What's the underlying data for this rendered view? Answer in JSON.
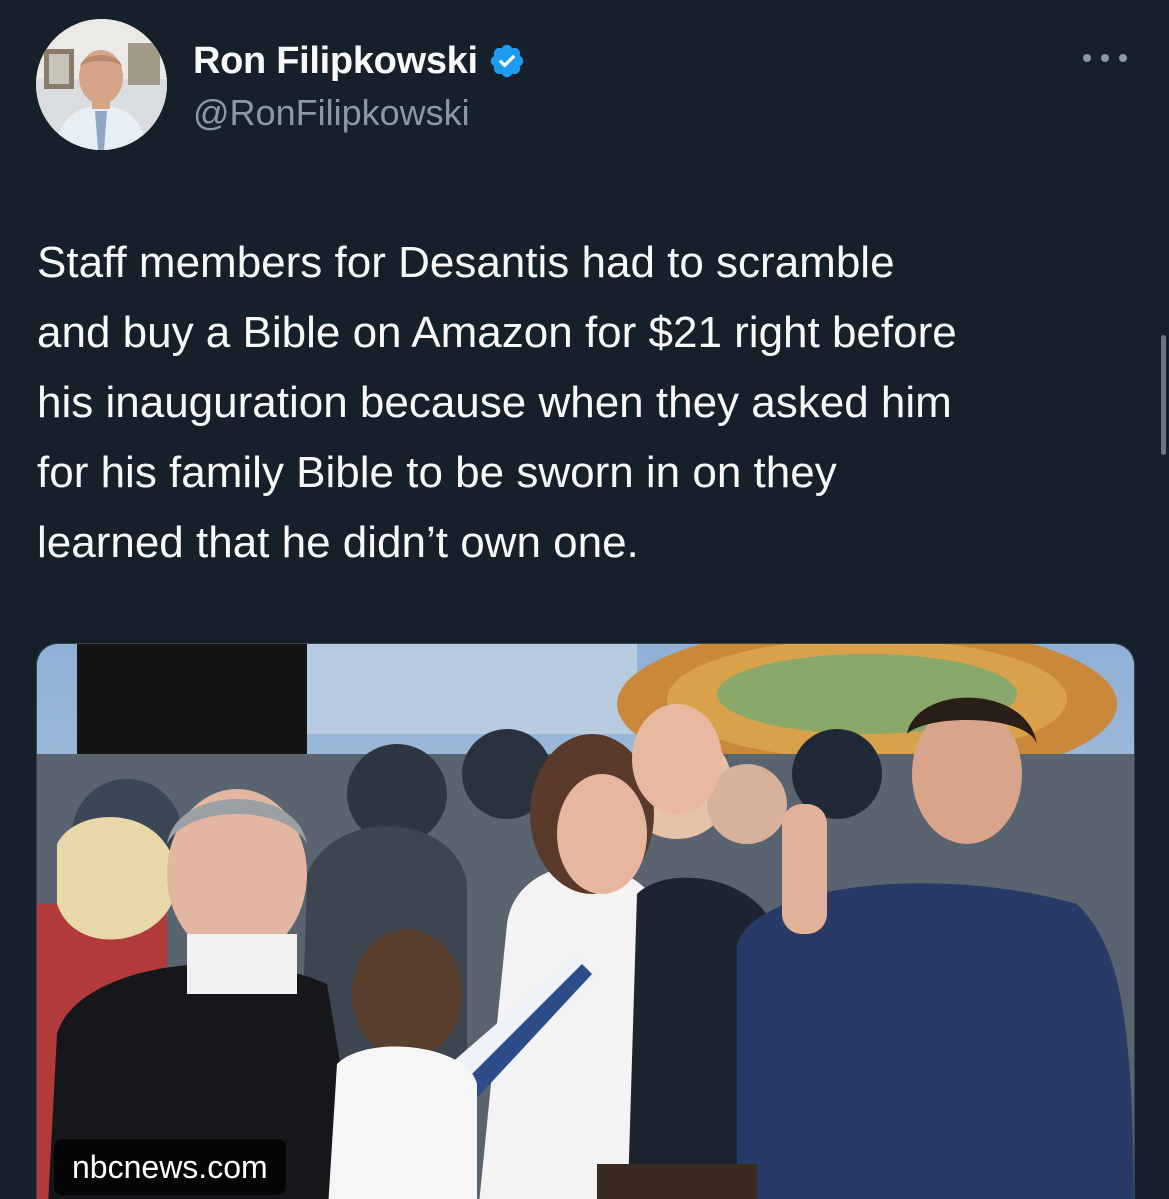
{
  "author": {
    "display_name": "Ron Filipkowski",
    "handle": "@RonFilipkowski",
    "verified": true,
    "avatar_icon": "profile-photo"
  },
  "more_icon": "more-options-icon",
  "tweet": {
    "text": "Staff members for Desantis had to scramble\nand buy a Bible on Amazon for $21 right before\nhis inauguration because when they asked him\nfor his family Bible to be sworn in on they\nlearned that he didn’t own one."
  },
  "media": {
    "source": "nbcnews.com"
  },
  "colors": {
    "background": "#15202b",
    "text": "#f7f9f9",
    "secondary_text": "#8b98a5",
    "verified_badge": "#1d9bf0"
  }
}
